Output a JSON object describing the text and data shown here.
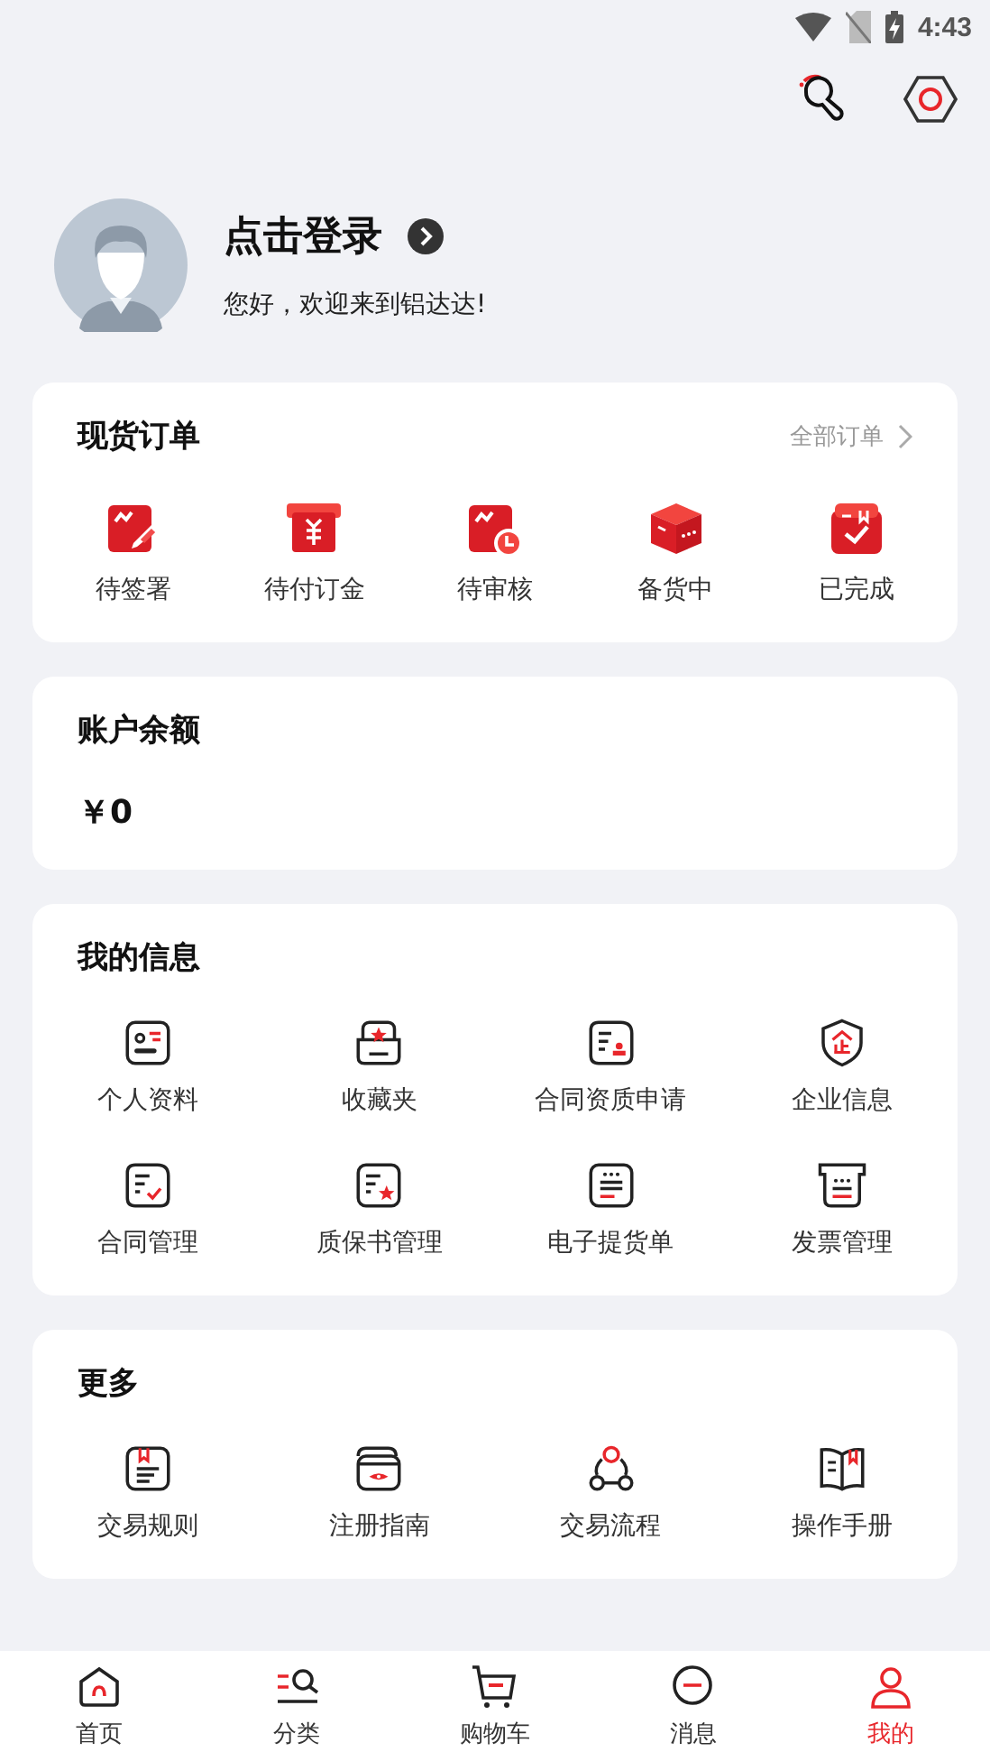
{
  "status_bar": {
    "time": "4:43"
  },
  "profile": {
    "title": "点击登录",
    "greeting": "您好，欢迎来到铝达达!"
  },
  "orders": {
    "title": "现货订单",
    "all_link": "全部订单",
    "items": [
      {
        "label": "待签署",
        "kind": "sign"
      },
      {
        "label": "待付订金",
        "kind": "pay"
      },
      {
        "label": "待审核",
        "kind": "review"
      },
      {
        "label": "备货中",
        "kind": "stock"
      },
      {
        "label": "已完成",
        "kind": "done"
      }
    ]
  },
  "balance": {
    "title": "账户余额",
    "amount": "￥0"
  },
  "my_info": {
    "title": "我的信息",
    "items": [
      {
        "label": "个人资料",
        "kind": "profile"
      },
      {
        "label": "收藏夹",
        "kind": "favorite"
      },
      {
        "label": "合同资质申请",
        "kind": "qualify"
      },
      {
        "label": "企业信息",
        "kind": "company"
      },
      {
        "label": "合同管理",
        "kind": "contract"
      },
      {
        "label": "质保书管理",
        "kind": "warranty"
      },
      {
        "label": "电子提货单",
        "kind": "delivery"
      },
      {
        "label": "发票管理",
        "kind": "invoice"
      }
    ]
  },
  "more": {
    "title": "更多",
    "items": [
      {
        "label": "交易规则",
        "kind": "rules"
      },
      {
        "label": "注册指南",
        "kind": "guide"
      },
      {
        "label": "交易流程",
        "kind": "flow"
      },
      {
        "label": "操作手册",
        "kind": "manual"
      }
    ]
  },
  "tab_bar": [
    {
      "label": "首页",
      "kind": "home",
      "selected": false
    },
    {
      "label": "分类",
      "kind": "category",
      "selected": false
    },
    {
      "label": "购物车",
      "kind": "cart",
      "selected": false
    },
    {
      "label": "消息",
      "kind": "message",
      "selected": false
    },
    {
      "label": "我的",
      "kind": "mine",
      "selected": true
    }
  ]
}
